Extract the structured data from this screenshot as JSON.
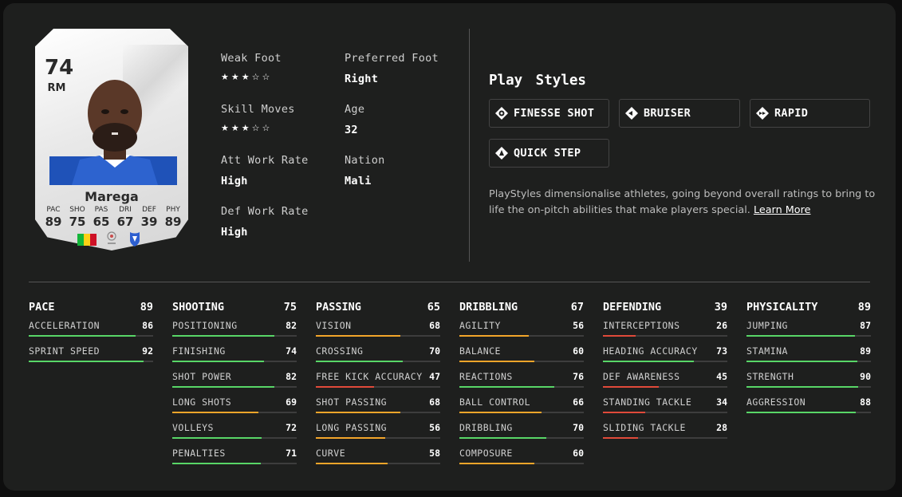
{
  "card": {
    "overall": "74",
    "position": "RM",
    "name": "Marega",
    "stats": [
      {
        "label": "PAC",
        "value": "89"
      },
      {
        "label": "SHO",
        "value": "75"
      },
      {
        "label": "PAS",
        "value": "65"
      },
      {
        "label": "DRI",
        "value": "67"
      },
      {
        "label": "DEF",
        "value": "39"
      },
      {
        "label": "PHY",
        "value": "89"
      }
    ],
    "flag_colors": [
      "#14b53a",
      "#fcd116",
      "#ce1126"
    ]
  },
  "info": {
    "weak_foot_label": "Weak Foot",
    "weak_foot_stars": "★★★☆☆",
    "weak_foot_rating": 3,
    "preferred_foot_label": "Preferred Foot",
    "preferred_foot_value": "Right",
    "skill_moves_label": "Skill Moves",
    "skill_moves_stars": "★★★☆☆",
    "skill_moves_rating": 3,
    "age_label": "Age",
    "age_value": "32",
    "att_work_rate_label": "Att Work Rate",
    "att_work_rate_value": "High",
    "nation_label": "Nation",
    "nation_value": "Mali",
    "def_work_rate_label": "Def Work Rate",
    "def_work_rate_value": "High"
  },
  "playstyles": {
    "title": "Play Styles",
    "items": [
      {
        "label": "FINESSE SHOT",
        "icon": "finesse-shot-icon"
      },
      {
        "label": "BRUISER",
        "icon": "bruiser-icon"
      },
      {
        "label": "RAPID",
        "icon": "rapid-icon"
      },
      {
        "label": "QUICK STEP",
        "icon": "quick-step-icon"
      }
    ],
    "description": "PlayStyles dimensionalise athletes, going beyond overall ratings to bring to life the on-pitch abilities that make players special.",
    "link_text": "Learn More"
  },
  "colors": {
    "green": "#58d667",
    "orange": "#f2a52a",
    "red": "#e04a3a"
  },
  "stat_groups": [
    {
      "name": "PACE",
      "value": "89",
      "attributes": [
        {
          "name": "ACCELERATION",
          "value": "86"
        },
        {
          "name": "SPRINT SPEED",
          "value": "92"
        }
      ]
    },
    {
      "name": "SHOOTING",
      "value": "75",
      "attributes": [
        {
          "name": "POSITIONING",
          "value": "82"
        },
        {
          "name": "FINISHING",
          "value": "74"
        },
        {
          "name": "SHOT POWER",
          "value": "82"
        },
        {
          "name": "LONG SHOTS",
          "value": "69"
        },
        {
          "name": "VOLLEYS",
          "value": "72"
        },
        {
          "name": "PENALTIES",
          "value": "71"
        }
      ]
    },
    {
      "name": "PASSING",
      "value": "65",
      "attributes": [
        {
          "name": "VISION",
          "value": "68"
        },
        {
          "name": "CROSSING",
          "value": "70"
        },
        {
          "name": "FREE KICK ACCURACY",
          "value": "47"
        },
        {
          "name": "SHOT PASSING",
          "value": "68"
        },
        {
          "name": "LONG PASSING",
          "value": "56"
        },
        {
          "name": "CURVE",
          "value": "58"
        }
      ]
    },
    {
      "name": "DRIBBLING",
      "value": "67",
      "attributes": [
        {
          "name": "AGILITY",
          "value": "56"
        },
        {
          "name": "BALANCE",
          "value": "60"
        },
        {
          "name": "REACTIONS",
          "value": "76"
        },
        {
          "name": "BALL CONTROL",
          "value": "66"
        },
        {
          "name": "DRIBBLING",
          "value": "70"
        },
        {
          "name": "COMPOSURE",
          "value": "60"
        }
      ]
    },
    {
      "name": "DEFENDING",
      "value": "39",
      "attributes": [
        {
          "name": "INTERCEPTIONS",
          "value": "26"
        },
        {
          "name": "HEADING ACCURACY",
          "value": "73"
        },
        {
          "name": "DEF AWARENESS",
          "value": "45"
        },
        {
          "name": "STANDING TACKLE",
          "value": "34"
        },
        {
          "name": "SLIDING TACKLE",
          "value": "28"
        }
      ]
    },
    {
      "name": "PHYSICALITY",
      "value": "89",
      "attributes": [
        {
          "name": "JUMPING",
          "value": "87"
        },
        {
          "name": "STAMINA",
          "value": "89"
        },
        {
          "name": "STRENGTH",
          "value": "90"
        },
        {
          "name": "AGGRESSION",
          "value": "88"
        }
      ]
    }
  ]
}
